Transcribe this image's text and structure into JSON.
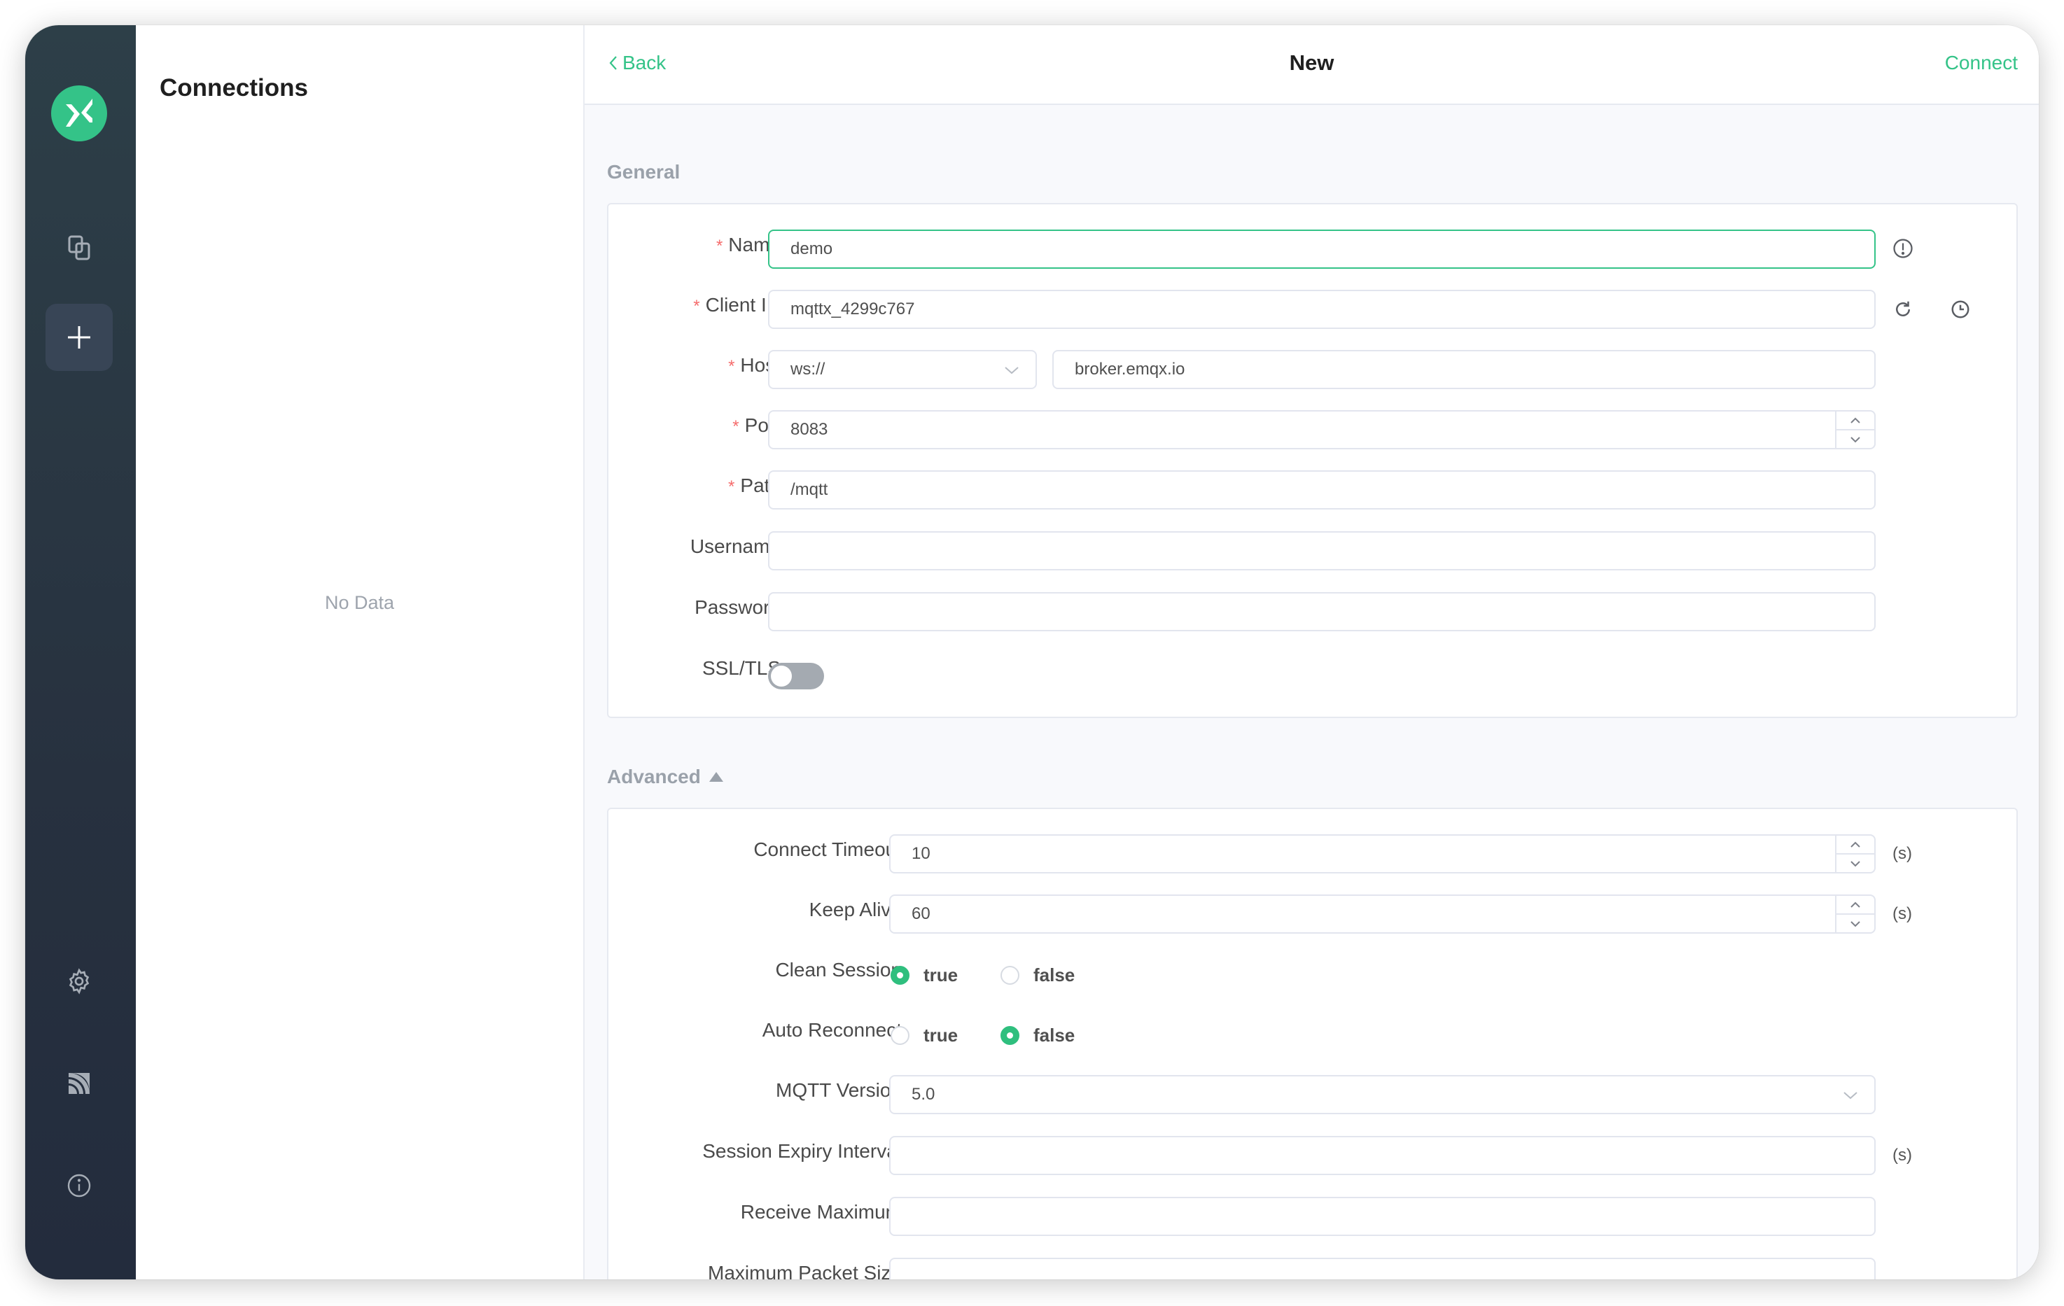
{
  "sidebar": {
    "logo": "mqttx-logo",
    "items": [
      {
        "name": "connections",
        "icon": "connections-icon",
        "active": false
      },
      {
        "name": "new-connection",
        "icon": "plus-icon",
        "active": true
      },
      {
        "name": "settings",
        "icon": "gear-icon",
        "active": false
      },
      {
        "name": "log",
        "icon": "feed-icon",
        "active": false
      },
      {
        "name": "about",
        "icon": "info-icon",
        "active": false
      }
    ]
  },
  "connections": {
    "title": "Connections",
    "empty_text": "No Data"
  },
  "header": {
    "back_label": "Back",
    "title": "New",
    "connect_label": "Connect"
  },
  "general": {
    "title": "General",
    "name": {
      "label": "Name",
      "required": true,
      "value": "demo",
      "icon": "info-icon"
    },
    "client_id": {
      "label": "Client ID",
      "required": true,
      "value": "mqttx_4299c767",
      "icons": [
        "refresh-icon",
        "clock-icon"
      ]
    },
    "host": {
      "label": "Host",
      "required": true,
      "protocol": "ws://",
      "value": "broker.emqx.io"
    },
    "port": {
      "label": "Port",
      "required": true,
      "value": "8083"
    },
    "path": {
      "label": "Path",
      "required": true,
      "value": "/mqtt"
    },
    "username": {
      "label": "Username",
      "value": ""
    },
    "password": {
      "label": "Password",
      "value": ""
    },
    "ssl_tls": {
      "label": "SSL/TLS",
      "enabled": false
    }
  },
  "advanced": {
    "title": "Advanced",
    "expanded": true,
    "connect_timeout": {
      "label": "Connect Timeout",
      "value": "10",
      "unit": "(s)"
    },
    "keep_alive": {
      "label": "Keep Alive",
      "value": "60",
      "unit": "(s)"
    },
    "clean_session": {
      "label": "Clean Session",
      "options": [
        "true",
        "false"
      ],
      "selected": "true"
    },
    "auto_reconnect": {
      "label": "Auto Reconnect",
      "options": [
        "true",
        "false"
      ],
      "selected": "false"
    },
    "mqtt_version": {
      "label": "MQTT Version",
      "value": "5.0"
    },
    "session_expiry": {
      "label": "Session Expiry Interval",
      "value": "",
      "unit": "(s)"
    },
    "receive_maximum": {
      "label": "Receive Maximum",
      "value": ""
    },
    "max_packet_size": {
      "label": "Maximum Packet Size",
      "value": ""
    }
  },
  "colors": {
    "accent": "#34c388",
    "sidebar": "#2b3744",
    "required": "#f56c6c"
  }
}
